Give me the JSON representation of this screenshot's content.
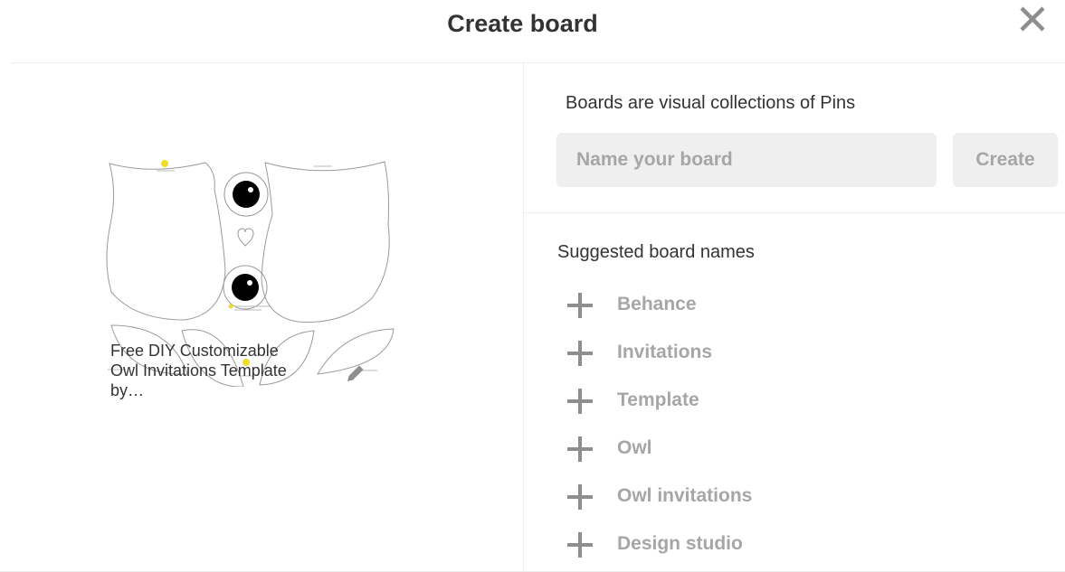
{
  "header": {
    "title": "Create board"
  },
  "pin": {
    "description_lines": [
      "Free DIY Customizable",
      "Owl Invitations Template",
      "by…"
    ]
  },
  "form": {
    "intro": "Boards are visual collections of Pins",
    "name_placeholder": "Name your board",
    "create_label": "Create"
  },
  "suggestions": {
    "heading": "Suggested board names",
    "items": [
      {
        "label": "Behance"
      },
      {
        "label": "Invitations"
      },
      {
        "label": "Template"
      },
      {
        "label": "Owl"
      },
      {
        "label": "Owl invitations"
      },
      {
        "label": "Design studio"
      }
    ]
  },
  "icons": {
    "close": "close-icon",
    "edit": "pencil-icon",
    "add": "plus-icon"
  },
  "colors": {
    "text": "#333333",
    "muted": "#a6a6a6",
    "field_bg": "#efefef",
    "divider": "#ececec"
  }
}
